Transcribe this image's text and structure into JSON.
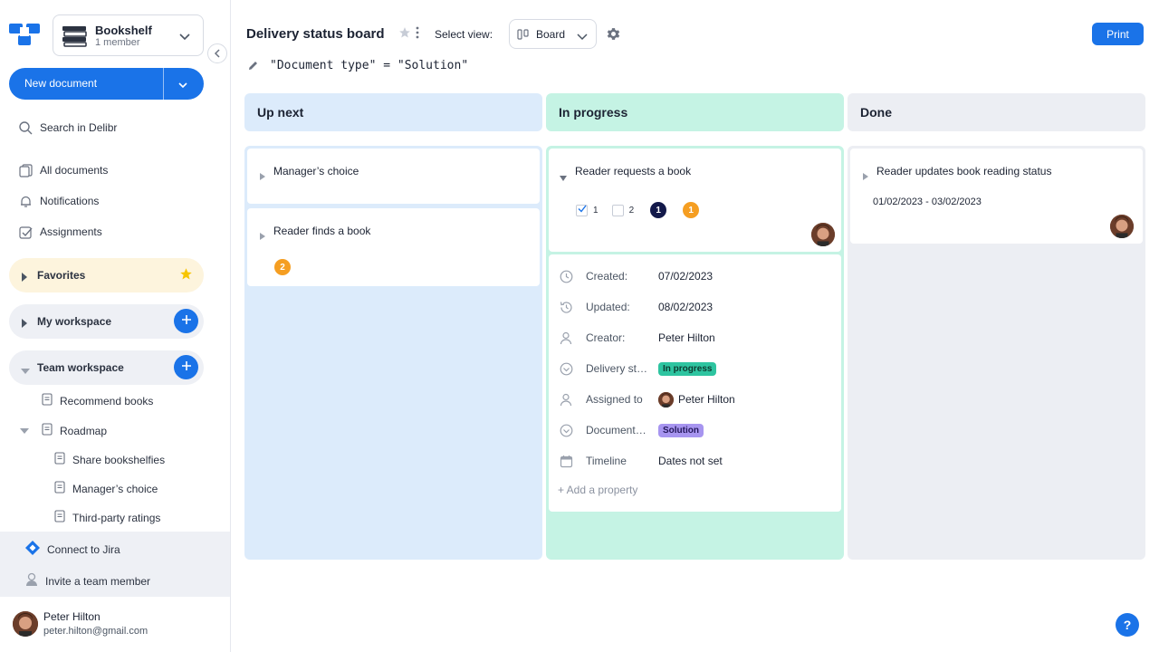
{
  "colors": {
    "accent": "#1a73e8",
    "up_next_bg": "#dcebfb",
    "in_progress_bg": "#c5f3e4",
    "done_bg": "#eceef3",
    "favorites_bg": "#fdf4dd",
    "badge_orange": "#f59e22",
    "badge_navy": "#13194a",
    "tag_in_progress": "#2ec4a0",
    "tag_solution": "#a795f0"
  },
  "workspace": {
    "name": "Bookshelf",
    "members": "1 member"
  },
  "sidebar": {
    "new_document": "New document",
    "search": "Search in Delibr",
    "nav": [
      {
        "label": "All documents",
        "icon": "documents-icon"
      },
      {
        "label": "Notifications",
        "icon": "bell-icon"
      },
      {
        "label": "Assignments",
        "icon": "checkbox-icon"
      }
    ],
    "favorites": "Favorites",
    "my_workspace": "My workspace",
    "team_workspace": "Team workspace",
    "tree": [
      "Recommend books",
      "Roadmap",
      "Share bookshelfies",
      "Manager’s choice",
      "Third-party ratings"
    ],
    "connect_jira": "Connect to Jira",
    "invite": "Invite a team member"
  },
  "user": {
    "name": "Peter Hilton",
    "email": "peter.hilton@gmail.com"
  },
  "header": {
    "title": "Delivery status board",
    "select_view_label": "Select view:",
    "view_value": "Board",
    "print": "Print",
    "filter": "\"Document type\" = \"Solution\""
  },
  "columns": [
    {
      "title": "Up next",
      "cards": [
        {
          "title": "Manager’s choice"
        },
        {
          "title": "Reader finds a book",
          "badge": "2"
        }
      ]
    },
    {
      "title": "In progress",
      "cards": [
        {
          "title": "Reader requests a book",
          "checks": [
            {
              "label": "1",
              "checked": true
            },
            {
              "label": "2",
              "checked": false
            }
          ],
          "badges": [
            "1",
            "1"
          ],
          "properties": [
            {
              "label": "Created:",
              "value": "07/02/2023",
              "icon": "clock-icon"
            },
            {
              "label": "Updated:",
              "value": "08/02/2023",
              "icon": "history-icon"
            },
            {
              "label": "Creator:",
              "value": "Peter Hilton",
              "icon": "person-icon"
            },
            {
              "label": "Delivery st…",
              "value": "In progress",
              "icon": "dropdown-circle-icon"
            },
            {
              "label": "Assigned to",
              "value": "Peter Hilton",
              "icon": "person-icon"
            },
            {
              "label": "Document…",
              "value": "Solution",
              "icon": "dropdown-circle-icon"
            },
            {
              "label": "Timeline",
              "value": "Dates not set",
              "icon": "calendar-icon"
            }
          ],
          "add_property": "+ Add a property"
        }
      ]
    },
    {
      "title": "Done",
      "cards": [
        {
          "title": "Reader updates book reading status",
          "dates": "01/02/2023 - 03/02/2023"
        }
      ]
    }
  ],
  "help": "?"
}
